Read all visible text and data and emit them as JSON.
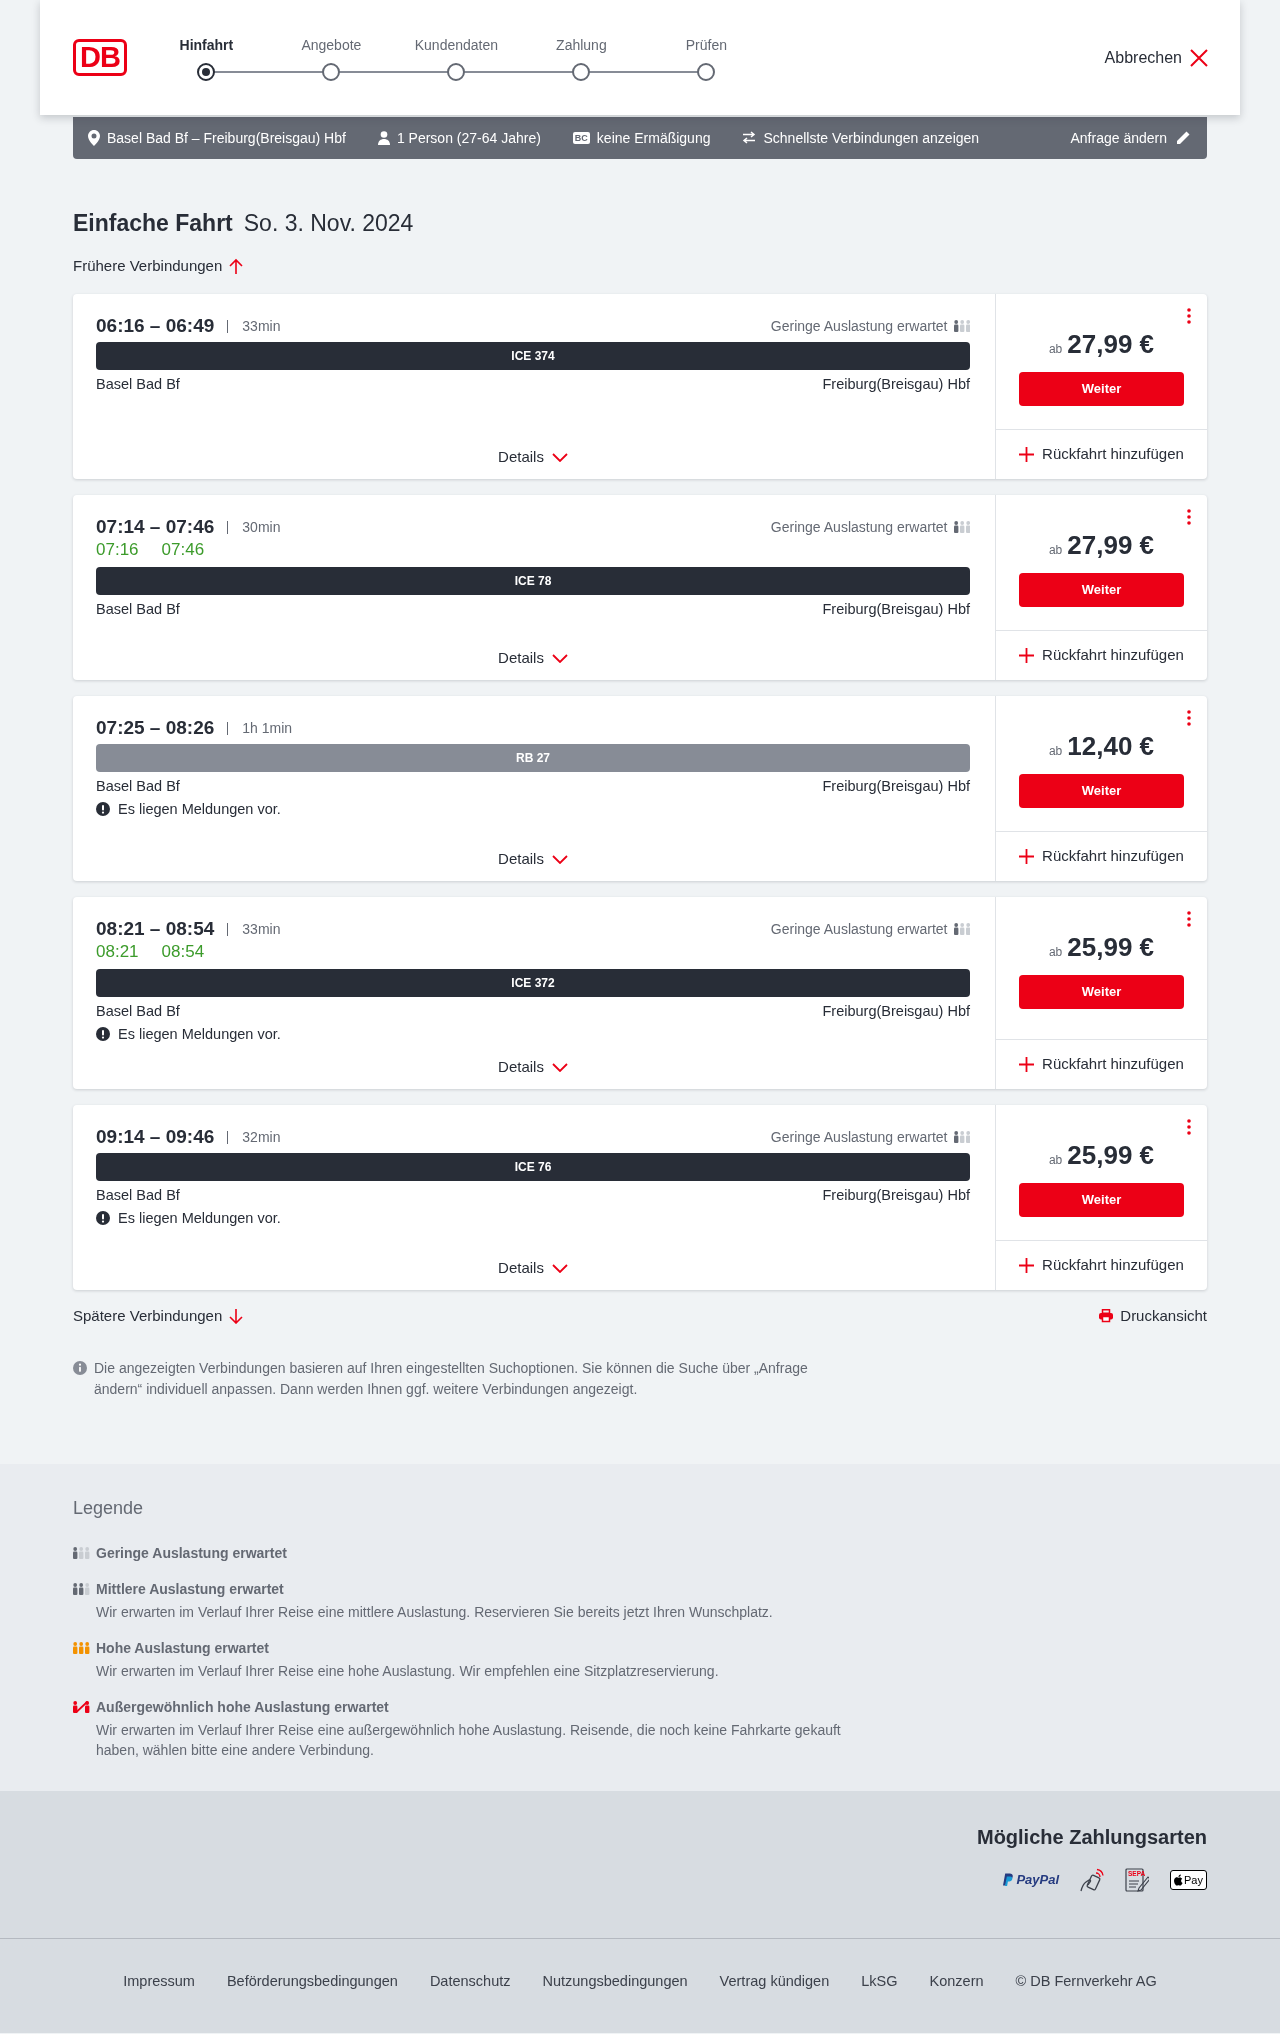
{
  "header": {
    "logo": "DB",
    "steps": [
      {
        "label": "Hinfahrt",
        "current": true
      },
      {
        "label": "Angebote",
        "current": false
      },
      {
        "label": "Kundendaten",
        "current": false
      },
      {
        "label": "Zahlung",
        "current": false
      },
      {
        "label": "Prüfen",
        "current": false
      }
    ],
    "cancel": "Abbrechen"
  },
  "summary_bar": {
    "route": "Basel Bad Bf – Freiburg(Breisgau) Hbf",
    "passengers": "1 Person (27-64 Jahre)",
    "discount_badge": "BC",
    "discount": "keine Ermäßigung",
    "search_option": "Schnellste Verbindungen anzeigen",
    "edit": "Anfrage ändern"
  },
  "heading": {
    "trip_type": "Einfache Fahrt",
    "date": "So. 3. Nov. 2024"
  },
  "earlier_connections": "Frühere Verbindungen",
  "connections": [
    {
      "times": "06:16 – 06:49",
      "duration": "33min",
      "occupancy": {
        "kind": "low",
        "text": "Geringe Auslastung erwartet"
      },
      "train": {
        "kind": "express",
        "name": "ICE 374"
      },
      "from": "Basel Bad Bf",
      "to": "Freiburg(Breisgau) Hbf",
      "details": {
        "label": "Details",
        "expanded": false
      },
      "price_prefix": "ab",
      "price": "27,99 €",
      "continue": "Weiter",
      "add_return": "Rückfahrt hinzufügen"
    },
    {
      "times": "07:14 – 07:46",
      "duration": "30min",
      "occupancy": {
        "kind": "low",
        "text": "Geringe Auslastung erwartet"
      },
      "realtime": {
        "departure": "07:16",
        "arrival": "07:46",
        "punctual": true
      },
      "train": {
        "kind": "express",
        "name": "ICE 78"
      },
      "from": "Basel Bad Bf",
      "to": "Freiburg(Breisgau) Hbf",
      "details": {
        "label": "Details",
        "expanded": false
      },
      "price_prefix": "ab",
      "price": "27,99 €",
      "continue": "Weiter",
      "add_return": "Rückfahrt hinzufügen"
    },
    {
      "times": "07:25 – 08:26",
      "duration": "1h 1min",
      "train": {
        "kind": "regional",
        "name": "RB 27"
      },
      "from": "Basel Bad Bf",
      "to": "Freiburg(Breisgau) Hbf",
      "notice": "Es liegen Meldungen vor.",
      "details": {
        "label": "Details",
        "expanded": false
      },
      "price_prefix": "ab",
      "price": "12,40 €",
      "continue": "Weiter",
      "add_return": "Rückfahrt hinzufügen"
    },
    {
      "times": "08:21 – 08:54",
      "duration": "33min",
      "occupancy": {
        "kind": "low",
        "text": "Geringe Auslastung erwartet"
      },
      "realtime": {
        "departure": "08:21",
        "arrival": "08:54",
        "punctual": true
      },
      "train": {
        "kind": "express",
        "name": "ICE 372"
      },
      "from": "Basel Bad Bf",
      "to": "Freiburg(Breisgau) Hbf",
      "notice": "Es liegen Meldungen vor.",
      "details": {
        "label": "Details",
        "expanded": false
      },
      "price_prefix": "ab",
      "price": "25,99 €",
      "continue": "Weiter",
      "add_return": "Rückfahrt hinzufügen"
    },
    {
      "times": "09:14 – 09:46",
      "duration": "32min",
      "occupancy": {
        "kind": "low",
        "text": "Geringe Auslastung erwartet"
      },
      "train": {
        "kind": "express",
        "name": "ICE 76"
      },
      "from": "Basel Bad Bf",
      "to": "Freiburg(Breisgau) Hbf",
      "notice": "Es liegen Meldungen vor.",
      "details": {
        "label": "Details",
        "expanded": false
      },
      "price_prefix": "ab",
      "price": "25,99 €",
      "continue": "Weiter",
      "add_return": "Rückfahrt hinzufügen"
    }
  ],
  "later_connections": "Spätere Verbindungen",
  "print_view": "Druckansicht",
  "info_note": "Die angezeigten Verbindungen basieren auf Ihren eingestellten Suchoptionen. Sie können die Suche über „Anfrage ändern“ individuell anpassen. Dann werden Ihnen ggf. weitere Verbindungen angezeigt.",
  "legend": {
    "title": "Legende",
    "items": [
      {
        "kind": "low",
        "title": "Geringe Auslastung erwartet"
      },
      {
        "kind": "medium",
        "title": "Mittlere Auslastung erwartet",
        "description": "Wir erwarten im Verlauf Ihrer Reise eine mittlere Auslastung. Reservieren Sie bereits jetzt Ihren Wunschplatz."
      },
      {
        "kind": "high",
        "title": "Hohe Auslastung erwartet",
        "description": "Wir erwarten im Verlauf Ihrer Reise eine hohe Auslastung. Wir empfehlen eine Sitzplatzreservierung."
      },
      {
        "kind": "exceptional",
        "title": "Außergewöhnlich hohe Auslastung erwartet",
        "description": "Wir erwarten im Verlauf Ihrer Reise eine außergewöhnlich hohe Auslastung. Reisende, die noch keine Fahrkarte gekauft haben, wählen bitte eine andere Verbindung."
      }
    ]
  },
  "payment": {
    "title": "Mögliche Zahlungsarten",
    "methods": [
      {
        "kind": "paypal",
        "label": "PayPal"
      },
      {
        "kind": "contactless"
      },
      {
        "kind": "sepa",
        "label": "SEPA"
      },
      {
        "kind": "applepay",
        "label": "Pay"
      }
    ]
  },
  "footer": {
    "links": [
      "Impressum",
      "Beförderungsbedingungen",
      "Datenschutz",
      "Nutzungsbedingungen",
      "Vertrag kündigen",
      "LkSG",
      "Konzern"
    ],
    "copyright": "© DB Fernverkehr AG"
  }
}
